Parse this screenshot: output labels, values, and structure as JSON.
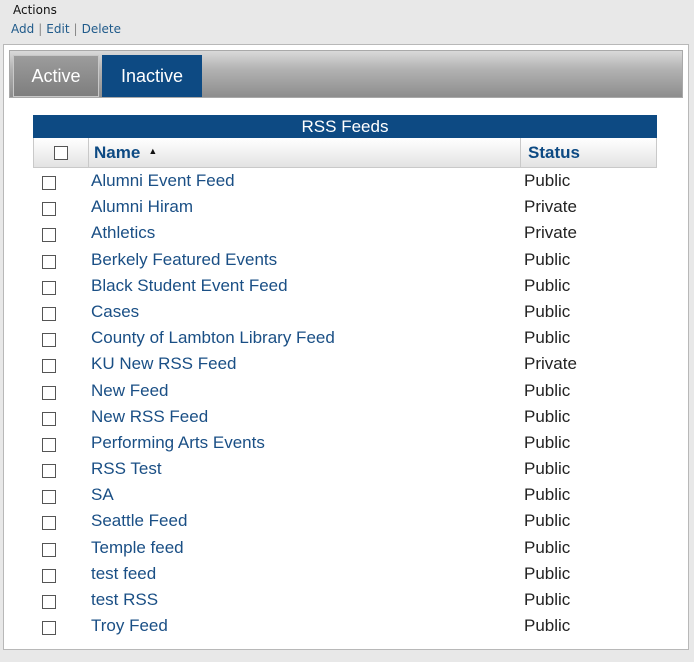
{
  "actions": {
    "title": "Actions",
    "add": "Add",
    "edit": "Edit",
    "delete": "Delete",
    "separator": "|"
  },
  "tabs": {
    "active": "Active",
    "inactive": "Inactive",
    "selected": "Inactive"
  },
  "table": {
    "caption": "RSS Feeds",
    "columns": {
      "name": "Name",
      "status": "Status"
    },
    "sort": {
      "column": "Name",
      "direction": "ascending",
      "icon": "sort-ascending-icon"
    },
    "rows": [
      {
        "name": "Alumni Event Feed",
        "status": "Public"
      },
      {
        "name": "Alumni Hiram",
        "status": "Private"
      },
      {
        "name": "Athletics",
        "status": "Private"
      },
      {
        "name": "Berkely Featured Events",
        "status": "Public"
      },
      {
        "name": "Black Student Event Feed",
        "status": "Public"
      },
      {
        "name": "Cases",
        "status": "Public"
      },
      {
        "name": "County of Lambton Library Feed",
        "status": "Public"
      },
      {
        "name": "KU New RSS Feed",
        "status": "Private"
      },
      {
        "name": "New Feed",
        "status": "Public"
      },
      {
        "name": "New RSS Feed",
        "status": "Public"
      },
      {
        "name": "Performing Arts Events",
        "status": "Public"
      },
      {
        "name": "RSS Test",
        "status": "Public"
      },
      {
        "name": "SA",
        "status": "Public"
      },
      {
        "name": "Seattle Feed",
        "status": "Public"
      },
      {
        "name": "Temple feed",
        "status": "Public"
      },
      {
        "name": "test feed",
        "status": "Public"
      },
      {
        "name": "test RSS",
        "status": "Public"
      },
      {
        "name": "Troy Feed",
        "status": "Public"
      }
    ]
  },
  "colors": {
    "brand_blue": "#0d4a83",
    "link_blue": "#1a4f85"
  }
}
